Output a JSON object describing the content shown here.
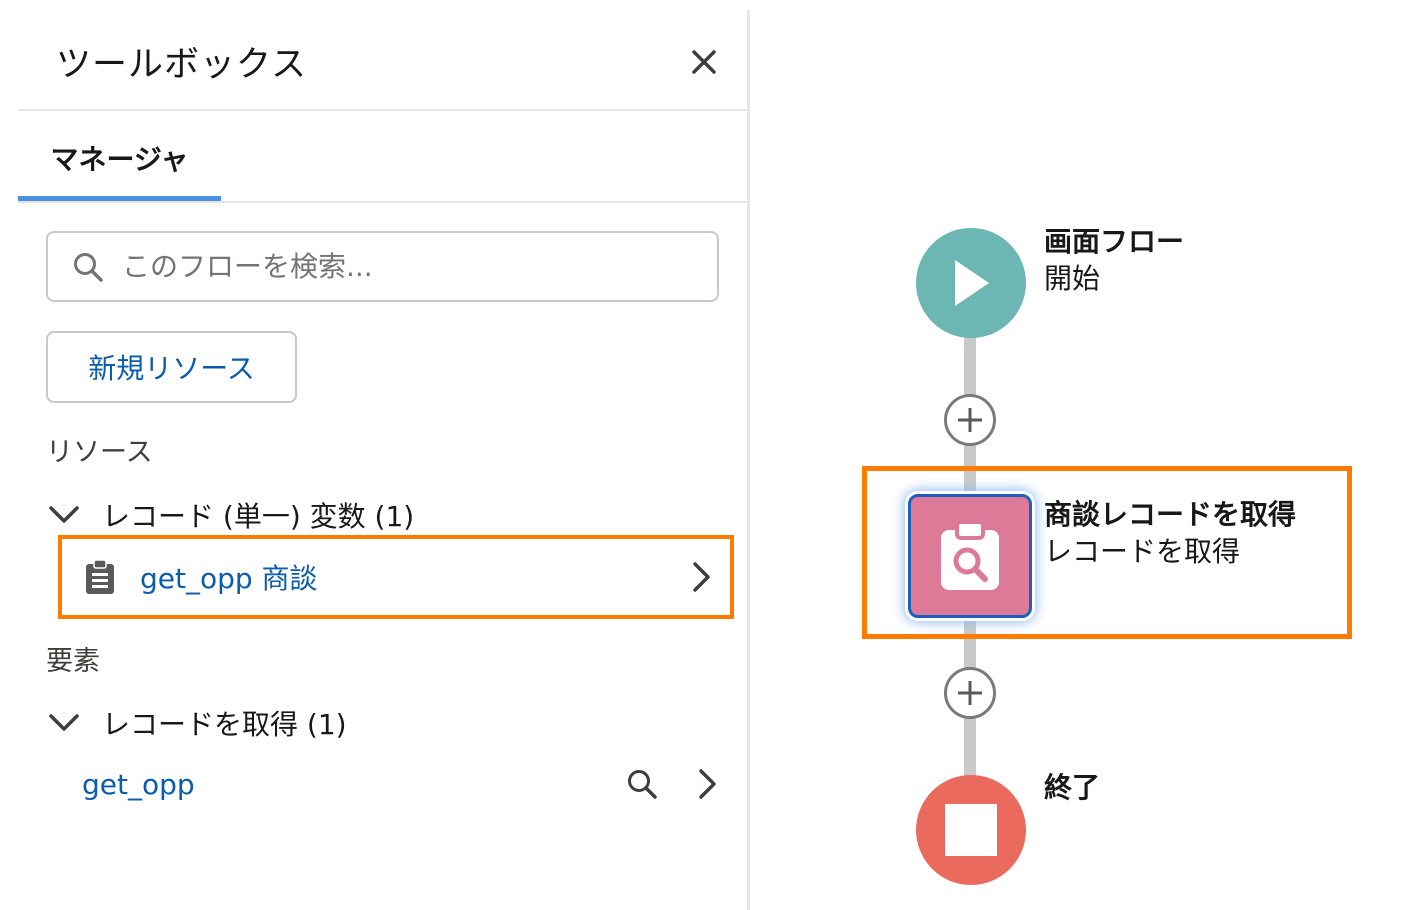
{
  "toolbox": {
    "title": "ツールボックス",
    "tabs": [
      {
        "label": "マネージャ",
        "active": true
      }
    ],
    "search": {
      "placeholder": "このフローを検索..."
    },
    "new_resource_label": "新規リソース",
    "resources_label": "リソース",
    "record_group": {
      "label": "レコード (単一) 変数 (1)",
      "items": [
        {
          "label": "get_opp 商談"
        }
      ]
    },
    "elements_label": "要素",
    "get_records_group": {
      "label": "レコードを取得 (1)",
      "items": [
        {
          "label": "get_opp"
        }
      ]
    }
  },
  "canvas": {
    "start": {
      "title": "画面フロー",
      "subtitle": "開始"
    },
    "get_records": {
      "title": "商談レコードを取得",
      "subtitle": "レコードを取得"
    },
    "end": {
      "title": "終了"
    }
  },
  "colors": {
    "accent": "#4a90e2",
    "link": "#0b5cab",
    "highlight": "#ff7a00",
    "start_node": "#6cb6b4",
    "get_records_node": "#dd7a98",
    "end_node": "#ea6b5d"
  },
  "icons": {
    "close": "close-icon",
    "search": "search-icon",
    "chevron_down": "chevron-down-icon",
    "chevron_right": "chevron-right-icon",
    "record": "clipboard-icon",
    "play": "play-icon",
    "add": "plus-icon",
    "stop": "stop-icon"
  }
}
